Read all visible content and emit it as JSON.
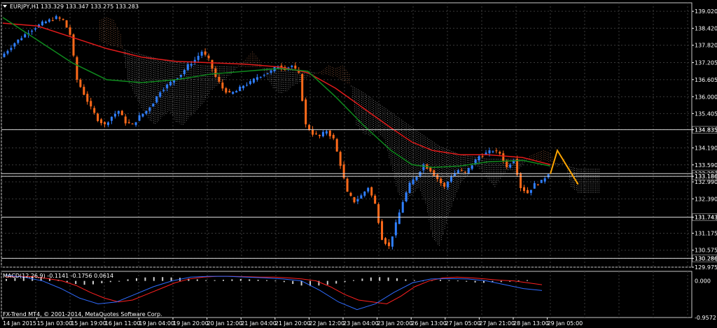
{
  "header": {
    "symbol": "EURJPY,H1",
    "ohlc": "133.329 133.347 133.275 133.283",
    "macd_label": "MACD(12,26,9) -0.1141 -0.1756 0.0614",
    "copyright": "FX-Trend MT4, © 2001-2014, MetaQuotes Software Corp."
  },
  "colors": {
    "background": "#000000",
    "grid": "#3a3a3a",
    "frame": "#c8c8c8",
    "bull": "#2f7fff",
    "bear": "#ff6a1a",
    "ma_fast": "#e21b1b",
    "ma_slow": "#0f8a1e",
    "cloud_up": "#ffffff",
    "cloud_down": "#ff9e66",
    "forecast": "#ffa500",
    "macd_signal": "#ff2020",
    "macd_main": "#2f6bff"
  },
  "chart_data": {
    "type": "candlestick",
    "ylim": [
      129.975,
      139.32
    ],
    "price_ticks": [
      "139.020",
      "138.420",
      "137.820",
      "137.205",
      "136.605",
      "136.000",
      "135.405",
      "134.835",
      "134.190",
      "133.590",
      "133.186",
      "132.990",
      "132.390",
      "131.743",
      "131.175",
      "130.575",
      "130.286",
      "129.975"
    ],
    "horizontal_levels": [
      {
        "value": 134.835,
        "label": "134.835"
      },
      {
        "value": 133.283,
        "label": "133.283"
      },
      {
        "value": 133.186,
        "label": "133.186"
      },
      {
        "value": 131.743,
        "label": "131.743"
      },
      {
        "value": 130.286,
        "label": "130.286"
      }
    ],
    "time_labels": [
      "14 Jan 2015",
      "15 Jan 03:00",
      "15 Jan 19:00",
      "16 Jan 11:00",
      "19 Jan 04:00",
      "19 Jan 20:00",
      "20 Jan 12:00",
      "21 Jan 04:00",
      "21 Jan 20:00",
      "22 Jan 12:00",
      "23 Jan 04:00",
      "23 Jan 20:00",
      "26 Jan 13:00",
      "27 Jan 05:00",
      "27 Jan 21:00",
      "28 Jan 13:00",
      "29 Jan 05:00"
    ],
    "close_path": [
      [
        0,
        137.4
      ],
      [
        4,
        137.9
      ],
      [
        8,
        138.3
      ],
      [
        12,
        138.6
      ],
      [
        16,
        138.8
      ],
      [
        18,
        138.7
      ],
      [
        20,
        138.2
      ],
      [
        22,
        136.6
      ],
      [
        24,
        136.1
      ],
      [
        26,
        135.6
      ],
      [
        28,
        135.2
      ],
      [
        30,
        135.0
      ],
      [
        32,
        135.3
      ],
      [
        34,
        135.5
      ],
      [
        36,
        135.1
      ],
      [
        38,
        135.0
      ],
      [
        40,
        135.3
      ],
      [
        42,
        135.5
      ],
      [
        44,
        135.8
      ],
      [
        46,
        136.2
      ],
      [
        48,
        136.4
      ],
      [
        50,
        136.6
      ],
      [
        52,
        136.8
      ],
      [
        54,
        137.1
      ],
      [
        56,
        137.3
      ],
      [
        58,
        137.6
      ],
      [
        60,
        137.3
      ],
      [
        62,
        136.7
      ],
      [
        64,
        136.3
      ],
      [
        66,
        136.1
      ],
      [
        68,
        136.2
      ],
      [
        70,
        136.4
      ],
      [
        72,
        136.5
      ],
      [
        74,
        136.7
      ],
      [
        76,
        136.8
      ],
      [
        78,
        136.9
      ],
      [
        80,
        137.1
      ],
      [
        82,
        137.0
      ],
      [
        84,
        137.1
      ],
      [
        86,
        136.8
      ],
      [
        88,
        135.0
      ],
      [
        90,
        134.7
      ],
      [
        92,
        134.6
      ],
      [
        94,
        134.8
      ],
      [
        96,
        134.5
      ],
      [
        98,
        133.6
      ],
      [
        100,
        132.6
      ],
      [
        102,
        132.3
      ],
      [
        104,
        132.5
      ],
      [
        106,
        132.8
      ],
      [
        108,
        132.2
      ],
      [
        110,
        131.0
      ],
      [
        112,
        130.7
      ],
      [
        114,
        131.5
      ],
      [
        116,
        132.3
      ],
      [
        118,
        132.9
      ],
      [
        120,
        133.2
      ],
      [
        122,
        133.6
      ],
      [
        124,
        133.4
      ],
      [
        126,
        133.1
      ],
      [
        128,
        132.8
      ],
      [
        130,
        133.2
      ],
      [
        132,
        133.4
      ],
      [
        134,
        133.3
      ],
      [
        136,
        133.6
      ],
      [
        138,
        133.9
      ],
      [
        140,
        134.0
      ],
      [
        142,
        134.1
      ],
      [
        144,
        134.0
      ],
      [
        146,
        133.5
      ],
      [
        148,
        133.8
      ],
      [
        150,
        132.8
      ],
      [
        152,
        132.6
      ],
      [
        154,
        132.9
      ],
      [
        156,
        133.0
      ],
      [
        158,
        133.3
      ]
    ],
    "ma_fast": [
      [
        0,
        138.6
      ],
      [
        10,
        138.5
      ],
      [
        20,
        138.1
      ],
      [
        30,
        137.7
      ],
      [
        40,
        137.4
      ],
      [
        50,
        137.25
      ],
      [
        60,
        137.2
      ],
      [
        70,
        137.15
      ],
      [
        80,
        137.05
      ],
      [
        88,
        136.85
      ],
      [
        96,
        136.3
      ],
      [
        104,
        135.6
      ],
      [
        112,
        134.9
      ],
      [
        118,
        134.4
      ],
      [
        124,
        134.1
      ],
      [
        132,
        133.95
      ],
      [
        140,
        133.95
      ],
      [
        150,
        133.85
      ],
      [
        158,
        133.6
      ]
    ],
    "ma_slow": [
      [
        0,
        138.8
      ],
      [
        10,
        138.0
      ],
      [
        20,
        137.2
      ],
      [
        30,
        136.6
      ],
      [
        40,
        136.5
      ],
      [
        50,
        136.6
      ],
      [
        60,
        136.8
      ],
      [
        70,
        136.9
      ],
      [
        80,
        137.0
      ],
      [
        88,
        136.9
      ],
      [
        96,
        136.0
      ],
      [
        104,
        135.0
      ],
      [
        112,
        134.1
      ],
      [
        118,
        133.6
      ],
      [
        124,
        133.5
      ],
      [
        132,
        133.55
      ],
      [
        140,
        133.7
      ],
      [
        150,
        133.75
      ],
      [
        158,
        133.55
      ]
    ],
    "forecast": [
      [
        158,
        133.28
      ],
      [
        160,
        134.1
      ],
      [
        166,
        132.9
      ]
    ],
    "macd_ylim": [
      -0.9572,
      0.25
    ],
    "macd_ticks": [
      "0.000",
      "-0.9572"
    ],
    "macd_hist": [
      0.05,
      0.08,
      0.1,
      0.12,
      0.1,
      0.07,
      0.03,
      -0.03,
      -0.08,
      -0.1,
      -0.09,
      -0.06,
      -0.03,
      0.0,
      0.04,
      0.07,
      0.09,
      0.1,
      0.1,
      0.09,
      0.08,
      0.06,
      0.04,
      0.02,
      0.02,
      0.03,
      0.04,
      0.05,
      0.04,
      0.03,
      0.02,
      0.01,
      -0.03,
      -0.08,
      -0.12,
      -0.13,
      -0.12,
      -0.1,
      -0.07,
      -0.03,
      0.02,
      0.06,
      0.09,
      0.1,
      0.09,
      0.07,
      0.04,
      0.02,
      0.01,
      0.02,
      0.03,
      0.02,
      0.01,
      -0.02,
      -0.04,
      -0.05,
      -0.04,
      -0.03,
      -0.02,
      0.01,
      0.02
    ],
    "macd_signal_line": [
      0.1,
      0.12,
      0.11,
      0.06,
      0.0,
      -0.12,
      -0.3,
      -0.45,
      -0.55,
      -0.5,
      -0.35,
      -0.2,
      -0.05,
      0.05,
      0.1,
      0.12,
      0.12,
      0.11,
      0.1,
      0.1,
      0.08,
      0.05,
      0.0,
      -0.15,
      -0.35,
      -0.5,
      -0.55,
      -0.6,
      -0.4,
      -0.15,
      0.0,
      0.08,
      0.1,
      0.08,
      0.05,
      0.02,
      0.0,
      -0.05,
      -0.1
    ],
    "macd_main_line": [
      0.15,
      0.1,
      0.0,
      -0.2,
      -0.45,
      -0.6,
      -0.55,
      -0.35,
      -0.15,
      0.0,
      0.1,
      0.12,
      0.12,
      0.1,
      0.08,
      0.05,
      0.0,
      -0.25,
      -0.55,
      -0.75,
      -0.6,
      -0.3,
      -0.05,
      0.05,
      0.06,
      0.05,
      0.0,
      -0.1,
      -0.2,
      -0.25
    ]
  }
}
